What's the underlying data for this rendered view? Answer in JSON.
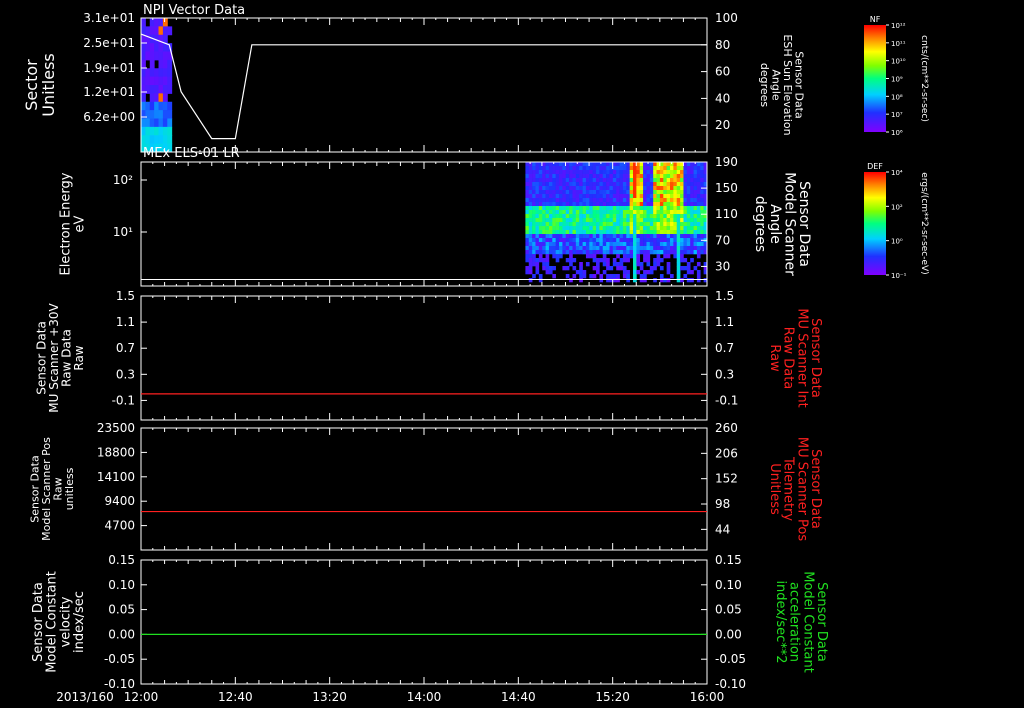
{
  "chart_data": [
    {
      "type": "heatmap",
      "title": "NPI Vector Data",
      "ylabel": [
        "Sector",
        "Unitless"
      ],
      "yticks": [
        "3.1e+01",
        "2.5e+01",
        "1.9e+01",
        "1.2e+01",
        "6.2e+00"
      ],
      "right_ylabel": [
        "Sensor Data",
        "ESH Sun Elevation",
        "Angle",
        "degrees"
      ],
      "right_yticks": [
        "100",
        "80",
        "60",
        "40",
        "20"
      ],
      "right_ylim": [
        0,
        100
      ],
      "line": {
        "t": [
          0,
          12,
          17,
          30,
          36,
          40,
          47,
          240
        ],
        "y": [
          88,
          80,
          45,
          10,
          10,
          10,
          80,
          80
        ]
      },
      "colorbar": {
        "label": "NF",
        "unit": "cnts/(cm**2-sr-sec)",
        "ticks": [
          "10¹²",
          "10¹¹",
          "10¹⁰",
          "10⁹",
          "10⁸",
          "10⁷",
          "10⁶"
        ]
      }
    },
    {
      "type": "heatmap",
      "title": "MEx ELS-01 LR",
      "ylabel": [
        "Electron Energy",
        "eV"
      ],
      "yticks": [
        "10²",
        "10¹"
      ],
      "right_ylabel": [
        "Sensor Data",
        "Model Scanner",
        "Angle",
        "degrees"
      ],
      "right_yticks": [
        "190",
        "150",
        "110",
        "70",
        "30"
      ],
      "right_ylim": [
        0,
        190
      ],
      "line_value": 10,
      "data_start": "14:43",
      "colorbar": {
        "label": "DEF",
        "unit": "ergs/(cm**2-sr-sec-eV)",
        "ticks": [
          "10⁴",
          "10²",
          "10⁰",
          "10⁻¹"
        ]
      }
    },
    {
      "type": "line",
      "ylabel": [
        "Sensor Data",
        "MU Scanner +30V",
        "Raw Data",
        "Raw"
      ],
      "yticks": [
        "1.5",
        "1.1",
        "0.7",
        "0.3",
        "-0.1"
      ],
      "right_ylabel": [
        "Sensor Data",
        "MU Scanner Int",
        "Raw Data",
        "Raw"
      ],
      "right_yticks": [
        "1.5",
        "1.1",
        "0.7",
        "0.3",
        "-0.1"
      ],
      "ylim": [
        -0.4,
        1.5
      ],
      "series": [
        {
          "values": [
            0
          ],
          "color": "#ff2020"
        }
      ]
    },
    {
      "type": "line",
      "ylabel": [
        "Sensor Data",
        "Model Scanner Pos",
        "Raw",
        "unitless"
      ],
      "yticks": [
        "23500",
        "18800",
        "14100",
        "9400",
        "4700"
      ],
      "right_ylabel": [
        "Sensor Data",
        "MU Scanner Pos",
        "Telemetry",
        "Unitless"
      ],
      "right_yticks": [
        "260",
        "206",
        "152",
        "98",
        "44"
      ],
      "ylim": [
        0,
        23500
      ],
      "series": [
        {
          "values": [
            7400
          ],
          "color": "#ff2020"
        }
      ]
    },
    {
      "type": "line",
      "ylabel": [
        "Sensor Data",
        "Model Constant",
        "velocity",
        "index/sec"
      ],
      "yticks": [
        "0.15",
        "0.10",
        "0.05",
        "0.00",
        "-0.05",
        "-0.10"
      ],
      "right_ylabel": [
        "Sensor Data",
        "Model Constant",
        "acceleration",
        "index/sec**2"
      ],
      "right_yticks": [
        "0.15",
        "0.10",
        "0.05",
        "0.00",
        "-0.05",
        "-0.10"
      ],
      "ylim": [
        -0.1,
        0.15
      ],
      "series": [
        {
          "values": [
            0.0
          ],
          "color": "#20e020"
        }
      ]
    }
  ],
  "xaxis": {
    "date": "2013/160",
    "ticks": [
      "12:00",
      "12:40",
      "13:20",
      "14:00",
      "14:40",
      "15:20",
      "16:00"
    ]
  },
  "colors": {
    "axis": "#ffffff",
    "red_label": "#ff2020",
    "green_label": "#20e020"
  }
}
